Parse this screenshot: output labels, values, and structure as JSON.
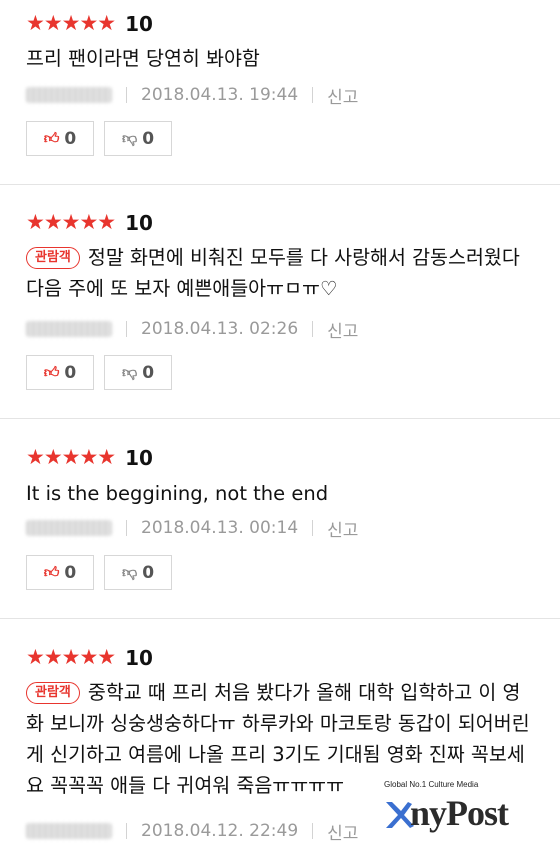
{
  "reviews": [
    {
      "stars": "★★★★★",
      "score": "10",
      "badge": "",
      "text": "프리 팬이라면 당연히 봐야함",
      "date": "2018.04.13. 19:44",
      "report": "신고",
      "likes": "0",
      "dislikes": "0"
    },
    {
      "stars": "★★★★★",
      "score": "10",
      "badge": "관람객",
      "text": "정말 화면에 비춰진 모두를 다 사랑해서 감동스러웠다 다음 주에 또 보자 예쁜애들아ㅠㅁㅠ♡",
      "date": "2018.04.13. 02:26",
      "report": "신고",
      "likes": "0",
      "dislikes": "0"
    },
    {
      "stars": "★★★★★",
      "score": "10",
      "badge": "",
      "text": "It is the beggining, not the end",
      "date": "2018.04.13. 00:14",
      "report": "신고",
      "likes": "0",
      "dislikes": "0"
    },
    {
      "stars": "★★★★★",
      "score": "10",
      "badge": "관람객",
      "text": "중학교 때 프리 처음 봤다가 올해 대학 입학하고 이 영화 보니까 싱숭생숭하다ㅠ 하루카와 마코토랑 동갑이 되어버린 게 신기하고 여름에 나올 프리 3기도 기대됨 영화 진짜 꼭보세요 꼭꼭꼭 애들 다 귀여워 죽음ㅠㅠㅠㅠ",
      "date": "2018.04.12. 22:49",
      "report": "신고",
      "likes": "",
      "dislikes": ""
    }
  ],
  "watermark": {
    "tagline": "Global No.1 Culture Media",
    "brand": "nyPost"
  },
  "colors": {
    "accent": "#e8352e",
    "muted": "#9a9a9a"
  },
  "icons": {
    "like": "thumbs-up-icon",
    "dislike": "thumbs-down-icon"
  }
}
